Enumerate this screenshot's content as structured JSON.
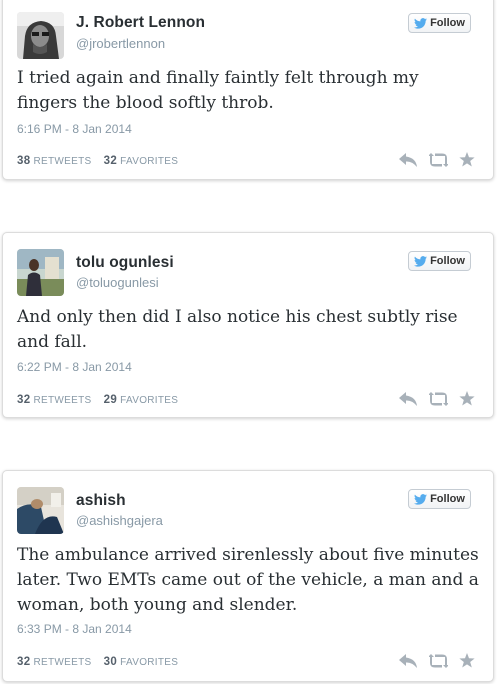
{
  "colors": {
    "name": "#292f33",
    "meta": "#8899a6",
    "icon": "#a8b1b9",
    "bird": "#55acee"
  },
  "tweets": [
    {
      "name": "J. Robert Lennon",
      "handle": "@jrobertlennon",
      "text": "I tried again and finally faintly felt through my fingers the blood softly throb.",
      "timestamp": "6:16 PM - 8 Jan 2014",
      "retweets": "38",
      "favorites": "32",
      "follow_label": "Follow",
      "retweets_label": "RETWEETS",
      "favorites_label": "FAVORITES"
    },
    {
      "name": "tolu ogunlesi",
      "handle": "@toluogunlesi",
      "text": "And only then did I also notice his chest subtly rise and fall.",
      "timestamp": "6:22 PM - 8 Jan 2014",
      "retweets": "32",
      "favorites": "29",
      "follow_label": "Follow",
      "retweets_label": "RETWEETS",
      "favorites_label": "FAVORITES"
    },
    {
      "name": "ashish",
      "handle": "@ashishgajera",
      "text": "The ambulance arrived sirenlessly about five minutes later. Two EMTs came out of the vehicle, a man and a woman, both young and slender.",
      "timestamp": "6:33 PM - 8 Jan 2014",
      "retweets": "32",
      "favorites": "30",
      "follow_label": "Follow",
      "retweets_label": "RETWEETS",
      "favorites_label": "FAVORITES"
    }
  ],
  "icons": {
    "follow": "twitter-bird-icon",
    "reply": "reply-icon",
    "retweet": "retweet-icon",
    "favorite": "star-icon"
  }
}
